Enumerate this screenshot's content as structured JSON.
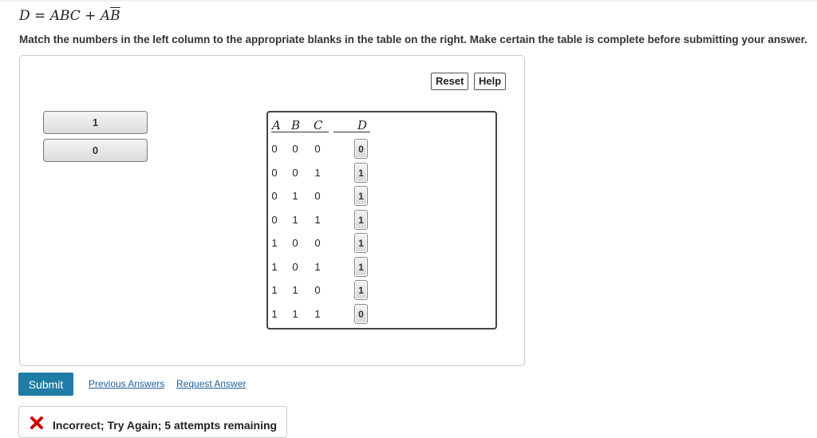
{
  "equation": {
    "lhs": "D",
    "eq": " = ",
    "term1": "ABC",
    "plus": " + ",
    "a": "A",
    "b_bar": "B"
  },
  "instructions": "Match the numbers in the left column to the appropriate blanks in the table on the right. Make certain the table is complete before submitting your answer.",
  "toolbar": {
    "reset_label": "Reset",
    "help_label": "Help"
  },
  "source_items": [
    "1",
    "0"
  ],
  "table": {
    "headers": {
      "a": "A",
      "b": "B",
      "c": "C",
      "d": "D"
    },
    "rows": [
      {
        "a": "0",
        "b": "0",
        "c": "0",
        "d": "0"
      },
      {
        "a": "0",
        "b": "0",
        "c": "1",
        "d": "1"
      },
      {
        "a": "0",
        "b": "1",
        "c": "0",
        "d": "1"
      },
      {
        "a": "0",
        "b": "1",
        "c": "1",
        "d": "1"
      },
      {
        "a": "1",
        "b": "0",
        "c": "0",
        "d": "1"
      },
      {
        "a": "1",
        "b": "0",
        "c": "1",
        "d": "1"
      },
      {
        "a": "1",
        "b": "1",
        "c": "0",
        "d": "1"
      },
      {
        "a": "1",
        "b": "1",
        "c": "1",
        "d": "0"
      }
    ]
  },
  "actions": {
    "submit_label": "Submit",
    "previous_answers_label": "Previous Answers",
    "request_answer_label": "Request Answer"
  },
  "feedback": {
    "text": "Incorrect; Try Again; 5 attempts remaining",
    "icon": "x-mark-icon",
    "icon_color": "#cc0000"
  },
  "colors": {
    "submit_bg": "#1f7ca5",
    "link": "#1f5c99"
  }
}
